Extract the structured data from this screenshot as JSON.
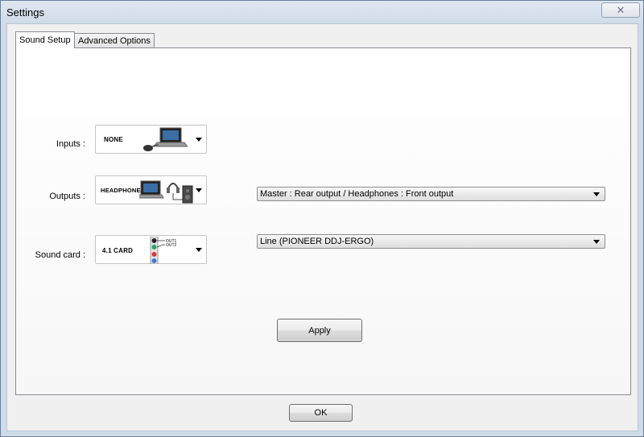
{
  "window": {
    "title": "Settings",
    "close_glyph": "✕"
  },
  "tabs": [
    {
      "label": "Sound Setup",
      "active": true
    },
    {
      "label": "Advanced Options",
      "active": false
    }
  ],
  "inputs": {
    "label": "Inputs :",
    "selected": "NONE",
    "icon": "laptop-with-mouse-icon"
  },
  "outputs": {
    "label": "Outputs :",
    "selected": "HEADPHONES",
    "icon": "laptop-headphones-speaker-icon",
    "routing": "Master : Rear output / Headphones : Front output"
  },
  "sound_card": {
    "label": "Sound card :",
    "selected": "4.1 CARD",
    "icon": "sound-card-jacks-icon",
    "jack_labels": [
      "OUT1",
      "OUT2"
    ],
    "device": "Line (PIONEER DDJ-ERGO)"
  },
  "buttons": {
    "apply": "Apply",
    "ok": "OK"
  },
  "colors": {
    "accent_border": "#6a7f96",
    "panel_bg": "#ffffff"
  }
}
